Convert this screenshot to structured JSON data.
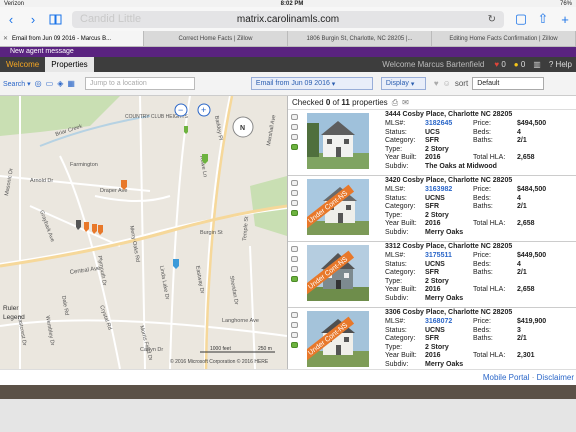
{
  "status": {
    "carrier": "Verizon",
    "time": "8:02 PM",
    "battery": "76%"
  },
  "browser": {
    "url": "matrix.carolinamls.com",
    "watermark": "Candid Little",
    "tabs": [
      {
        "label": "Email from Jun 09 2016 - Marcus B...",
        "active": true
      },
      {
        "label": "Correct Home Facts | Zillow"
      },
      {
        "label": "1806 Burgin St, Charlotte, NC 28205 |..."
      },
      {
        "label": "Editing Home Facts Confirmation | Zillow"
      }
    ]
  },
  "notice": "New agent message",
  "app": {
    "nav": [
      "Welcome",
      "Properties"
    ],
    "welcome_text": "Welcome Marcus Bartenfield",
    "heart_count": "0",
    "bulb_count": "0",
    "help": "Help"
  },
  "toolbar": {
    "search": "Search",
    "jump_placeholder": "Jump to a location",
    "email_select": "Email from Jun 09 2016",
    "display_select": "Display",
    "sort_label": "sort",
    "sort_value": "Default"
  },
  "list": {
    "checked_prefix": "Checked",
    "checked": "0",
    "of": "of",
    "total": "11",
    "suffix": "properties"
  },
  "labels": {
    "mls": "MLS#:",
    "status": "Status:",
    "category": "Category:",
    "type": "Type:",
    "year": "Year Built:",
    "subdiv": "Subdiv:",
    "price": "Price:",
    "beds": "Beds:",
    "baths": "Baths:",
    "hla": "Total HLA:"
  },
  "properties": [
    {
      "address": "3444 Cosby Place, Charlotte NC 28205",
      "mls": "3182645",
      "status": "UCS",
      "category": "SFR",
      "type": "2 Story",
      "year": "2016",
      "subdiv": "The Oaks at Midwood",
      "price": "$494,500",
      "beds": "4",
      "baths": "2/1",
      "hla": "2,658",
      "banner": ""
    },
    {
      "address": "3420 Cosby Place, Charlotte NC 28205",
      "mls": "3163982",
      "status": "UCNS",
      "category": "SFR",
      "type": "2 Story",
      "year": "2016",
      "subdiv": "Merry Oaks",
      "price": "$484,500",
      "beds": "4",
      "baths": "2/1",
      "hla": "2,658",
      "banner": "Under Cont-NS"
    },
    {
      "address": "3312 Cosby Place, Charlotte NC 28205",
      "mls": "3175511",
      "status": "UCNS",
      "category": "SFR",
      "type": "2 Story",
      "year": "2016",
      "subdiv": "Merry Oaks",
      "price": "$449,500",
      "beds": "4",
      "baths": "2/1",
      "hla": "2,658",
      "banner": "Under Cont-NS"
    },
    {
      "address": "3306 Cosby Place, Charlotte NC 28205",
      "mls": "3168072",
      "status": "UCNS",
      "category": "SFR",
      "type": "2 Story",
      "year": "2016",
      "subdiv": "Merry Oaks",
      "price": "$419,900",
      "beds": "3",
      "baths": "2/1",
      "hla": "2,301",
      "banner": "Under Cont-NS"
    }
  ],
  "map": {
    "labels": [
      "Briar Creek",
      "COUNTRY CLUB HEIGHTS",
      "Farmington",
      "Arnold Dr",
      "Masonic Dr",
      "Draper Ave",
      "Graybark Ave",
      "Central Ave",
      "Burgin St",
      "Eastway Dr",
      "Merry Oaks Rd",
      "Linda Lake Dr",
      "Plymouth Dr",
      "Crystal Rd",
      "Morris Field Dr",
      "Temple St",
      "Sheridan Dr",
      "Langhorne Ave",
      "Marshall Ave",
      "Ruler",
      "Legend",
      "Eastcrest Dr",
      "Wembley Dr",
      "Rowe Ln",
      "Barkley Pl",
      "Carlyn Dr",
      "Dale Rd"
    ],
    "scale_ft": "1000 feet",
    "scale_m": "250 m",
    "copyright": "© 2016 Microsoft Corporation © 2016 HERE"
  },
  "footer": {
    "mobile": "Mobile Portal",
    "sep": "·",
    "disclaimer": "Disclaimer"
  },
  "colors": {
    "accent_purple": "#5a2380",
    "link_blue": "#2a66c8",
    "banner_orange": "#e8782a"
  }
}
